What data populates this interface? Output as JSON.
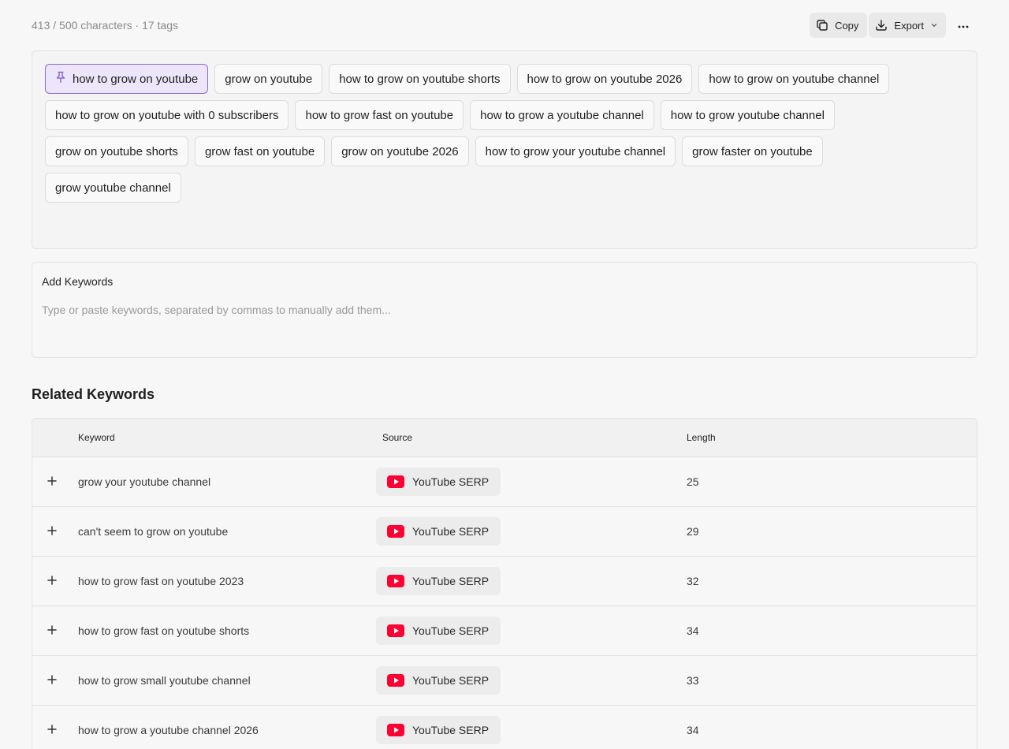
{
  "header": {
    "counter": "413 / 500 characters · 17 tags",
    "copy_label": "Copy",
    "export_label": "Export"
  },
  "tags": {
    "pinned": "how to grow on youtube",
    "rows": [
      [
        "how to grow on youtube",
        "grow on youtube",
        "how to grow on youtube shorts",
        "how to grow on youtube 2026",
        "how to grow on youtube channel"
      ],
      [
        "how to grow on youtube with 0 subscribers",
        "how to grow fast on youtube",
        "how to grow a youtube channel",
        "how to grow youtube channel"
      ],
      [
        "grow on youtube shorts",
        "grow fast on youtube",
        "grow on youtube 2026",
        "how to grow your youtube channel",
        "grow faster on youtube"
      ],
      [
        "grow youtube channel"
      ]
    ]
  },
  "add_keywords": {
    "title": "Add Keywords",
    "placeholder": "Type or paste keywords, separated by commas to manually add them..."
  },
  "related": {
    "title": "Related Keywords",
    "columns": {
      "keyword": "Keyword",
      "source": "Source",
      "length": "Length"
    },
    "rows": [
      {
        "keyword": "grow your youtube channel",
        "source": "YouTube SERP",
        "length": "25"
      },
      {
        "keyword": "can't seem to grow on youtube",
        "source": "YouTube SERP",
        "length": "29"
      },
      {
        "keyword": "how to grow fast on youtube 2023",
        "source": "YouTube SERP",
        "length": "32"
      },
      {
        "keyword": "how to grow fast on youtube shorts",
        "source": "YouTube SERP",
        "length": "34"
      },
      {
        "keyword": "how to grow small youtube channel",
        "source": "YouTube SERP",
        "length": "33"
      },
      {
        "keyword": "how to grow a youtube channel 2026",
        "source": "YouTube SERP",
        "length": "34"
      }
    ]
  },
  "colors": {
    "pinned_bg": "#ede6fb",
    "pinned_border": "#8c6ad1",
    "youtube_red": "#ff0033"
  }
}
